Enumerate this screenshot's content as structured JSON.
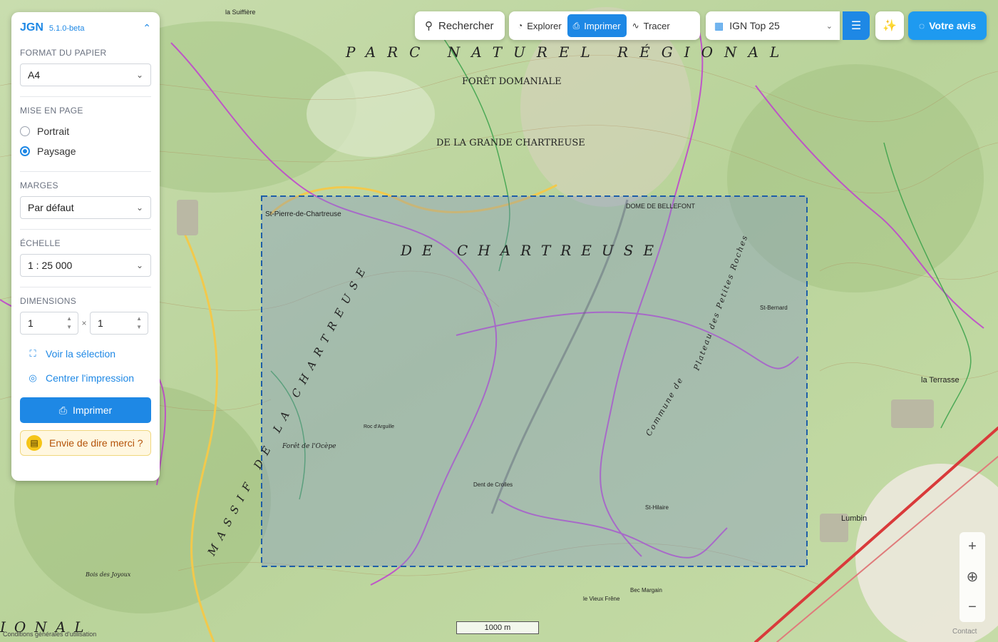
{
  "panel": {
    "app_name": "JGN",
    "version": "5.1.0-beta",
    "paper_format": {
      "label": "FORMAT DU PAPIER",
      "value": "A4"
    },
    "layout": {
      "label": "MISE EN PAGE",
      "options": [
        "Portrait",
        "Paysage"
      ],
      "selected": "Paysage"
    },
    "margins": {
      "label": "MARGES",
      "value": "Par défaut"
    },
    "scale": {
      "label": "ÉCHELLE",
      "value": "1 : 25 000"
    },
    "dimensions": {
      "label": "DIMENSIONS",
      "width": "1",
      "height": "1",
      "separator": "×"
    },
    "see_selection": "Voir la sélection",
    "center_print": "Centrer l'impression",
    "print_button": "Imprimer",
    "thanks_button": "Envie de dire merci ?"
  },
  "toolbar": {
    "search": "Rechercher",
    "modes": [
      "Explorer",
      "Imprimer",
      "Tracer"
    ],
    "active_mode": "Imprimer",
    "layer": "IGN Top 25",
    "feedback": "Votre avis"
  },
  "map": {
    "labels": [
      "PARC NATUREL RÉGIONAL",
      "FORÊT DOMANIALE",
      "DE LA GRANDE CHARTREUSE",
      "DE CHARTREUSE",
      "MASSIF DE LA CHARTREUSE",
      "St-Pierre-de-Chartreuse",
      "DOME DE BELLEFONT",
      "la Terrasse",
      "Lumbin",
      "Dent de Crolles",
      "St-Hilaire",
      "St-Bernard",
      "Plateau des Petites Roches",
      "Commune de",
      "la Suiffière",
      "Forêt de l'Ocèpe",
      "Roc d'Arguille",
      "Bois des Joyoux",
      "IONAL",
      "Bec Margain",
      "le Vieux Frêne"
    ],
    "scale_bar": "1000 m",
    "footer": "Conditions générales d'utilisation",
    "contact": "Contact",
    "colors": {
      "print_area": "#7a8fc8",
      "route": "#c040d0",
      "accent": "#1e88e5"
    }
  }
}
